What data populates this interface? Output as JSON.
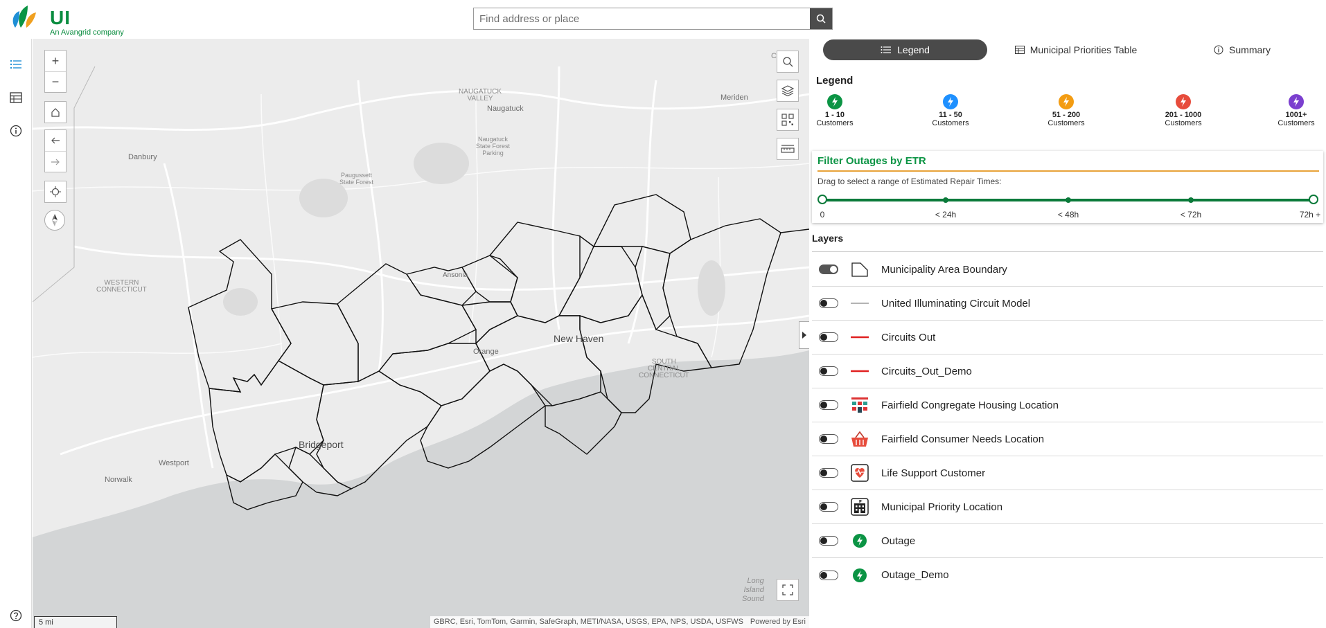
{
  "header": {
    "logo_text": "UI",
    "logo_sub": "An Avangrid company",
    "search_placeholder": "Find address or place"
  },
  "map": {
    "labels": {
      "naugatuck_valley": "NAUGATUCK\nVALLEY",
      "naugatuck": "Naugatuck",
      "naugatuck_forest": "Naugatuck\nState Forest\nParking",
      "meriden": "Meriden",
      "danbury": "Danbury",
      "paugussett": "Paugussett\nState Forest",
      "western_ct": "WESTERN\nCONNECTICUT",
      "ansonia": "Ansonia",
      "orange": "Orange",
      "new_haven": "New Haven",
      "south_central_ct": "SOUTH\nCENTRAL\nCONNECTICUT",
      "bridgeport": "Bridgeport",
      "westport": "Westport",
      "norwalk": "Norwalk",
      "long_island_sound": "Long\nIsland\nSound",
      "corner_fragment": "C"
    },
    "scale": "5 mi",
    "attribution": "GBRC, Esri, TomTom, Garmin, SafeGraph, METI/NASA, USGS, EPA, NPS, USDA, USFWS",
    "powered": "Powered by Esri"
  },
  "panel": {
    "tabs": [
      {
        "label": "Legend",
        "active": true
      },
      {
        "label": "Municipal Priorities Table",
        "active": false
      },
      {
        "label": "Summary",
        "active": false
      }
    ],
    "legend_title": "Legend",
    "legend_items": [
      {
        "range": "1 - 10",
        "unit": "Customers",
        "color": "#0b9444"
      },
      {
        "range": "11 - 50",
        "unit": "Customers",
        "color": "#1e90ff"
      },
      {
        "range": "51 - 200",
        "unit": "Customers",
        "color": "#f39c12"
      },
      {
        "range": "201 - 1000",
        "unit": "Customers",
        "color": "#e74c3c"
      },
      {
        "range": "1001+",
        "unit": "Customers",
        "color": "#7b3fcf"
      }
    ],
    "filter": {
      "title": "Filter Outages by ETR",
      "description": "Drag to select a range of Estimated Repair Times:",
      "stops": [
        "0",
        "< 24h",
        "< 48h",
        "< 72h",
        "72h +"
      ]
    },
    "layers_title": "Layers",
    "layers": [
      {
        "name": "Municipality Area Boundary",
        "on": true,
        "icon": "boundary-icon"
      },
      {
        "name": "United Illuminating Circuit Model",
        "on": false,
        "icon": "gray-line-icon"
      },
      {
        "name": "Circuits Out",
        "on": false,
        "icon": "red-line-icon"
      },
      {
        "name": "Circuits_Out_Demo",
        "on": false,
        "icon": "red-line-icon"
      },
      {
        "name": "Fairfield Congregate Housing Location",
        "on": false,
        "icon": "housing-icon"
      },
      {
        "name": "Fairfield Consumer Needs Location",
        "on": false,
        "icon": "basket-icon"
      },
      {
        "name": "Life Support Customer",
        "on": false,
        "icon": "heart-monitor-icon"
      },
      {
        "name": "Municipal Priority Location",
        "on": false,
        "icon": "building-icon"
      },
      {
        "name": "Outage",
        "on": false,
        "icon": "green-bolt-icon"
      },
      {
        "name": "Outage_Demo",
        "on": false,
        "icon": "green-bolt-icon"
      }
    ]
  },
  "colors": {
    "brand_green": "#0b9444",
    "filter_accent": "#e8a33a",
    "slider": "#0b7a3a",
    "tab_active": "#4a4a4a"
  }
}
